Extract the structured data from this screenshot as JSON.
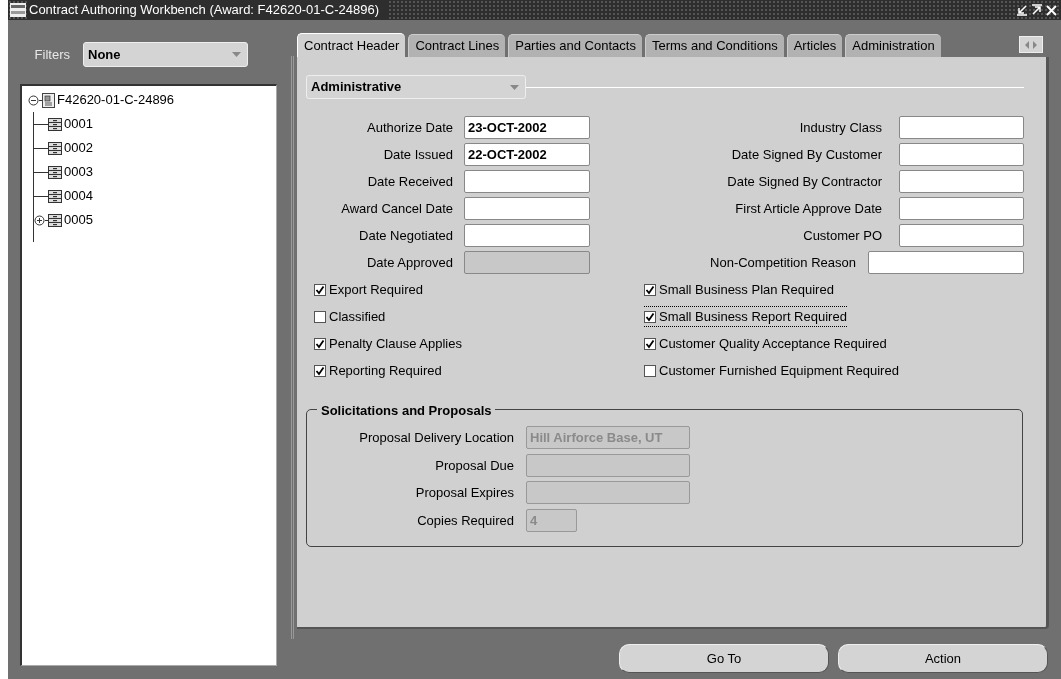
{
  "window": {
    "title": "Contract Authoring Workbench (Award: F42620-01-C-24896)"
  },
  "filters": {
    "label": "Filters",
    "value": "None"
  },
  "tree": [
    {
      "label": "F42620-01-C-24896",
      "kind": "contract",
      "expanded": true,
      "children": [
        {
          "label": "0001",
          "kind": "line"
        },
        {
          "label": "0002",
          "kind": "line"
        },
        {
          "label": "0003",
          "kind": "line"
        },
        {
          "label": "0004",
          "kind": "line"
        },
        {
          "label": "0005",
          "kind": "line",
          "expanded": false
        }
      ]
    }
  ],
  "tabs": [
    {
      "label": "Contract Header",
      "selected": true
    },
    {
      "label": "Contract Lines",
      "selected": false
    },
    {
      "label": "Parties and Contacts",
      "selected": false
    },
    {
      "label": "Terms and Conditions",
      "selected": false
    },
    {
      "label": "Articles",
      "selected": false
    },
    {
      "label": "Administration",
      "selected": false
    }
  ],
  "region_selector": {
    "value": "Administrative"
  },
  "fields_left": [
    {
      "label": "Authorize Date",
      "value": "23-OCT-2002",
      "disabled": false
    },
    {
      "label": "Date Issued",
      "value": "22-OCT-2002",
      "disabled": false
    },
    {
      "label": "Date Received",
      "disabled": false
    },
    {
      "label": "Award Cancel Date",
      "disabled": false
    },
    {
      "label": "Date Negotiated",
      "disabled": false
    },
    {
      "label": "Date Approved",
      "disabled": true
    }
  ],
  "fields_right": [
    {
      "label": "Industry Class",
      "kind": "normal"
    },
    {
      "label": "Date Signed By Customer",
      "kind": "normal"
    },
    {
      "label": "Date Signed By Contractor",
      "kind": "normal"
    },
    {
      "label": "First Article Approve Date",
      "kind": "normal"
    },
    {
      "label": "Customer PO",
      "kind": "normal"
    },
    {
      "label": "Non-Competition Reason",
      "kind": "wide"
    }
  ],
  "checkboxes_left": [
    {
      "label": "Export Required",
      "checked": true,
      "focused": false
    },
    {
      "label": "Classified",
      "checked": false,
      "focused": false
    },
    {
      "label": "Penalty Clause Applies",
      "checked": true,
      "focused": false
    },
    {
      "label": "Reporting Required",
      "checked": true,
      "focused": false
    }
  ],
  "checkboxes_right": [
    {
      "label": "Small Business Plan Required",
      "checked": true,
      "focused": false
    },
    {
      "label": "Small Business Report Required",
      "checked": true,
      "focused": true
    },
    {
      "label": "Customer Quality Acceptance Required",
      "checked": true,
      "focused": false
    },
    {
      "label": "Customer Furnished Equipment Required",
      "checked": false,
      "focused": false
    }
  ],
  "solicitations": {
    "title": "Solicitations and Proposals",
    "fields": [
      {
        "label": "Proposal Delivery Location",
        "value": "Hill Airforce Base, UT",
        "kind": "long",
        "disabled": true
      },
      {
        "label": "Proposal Due",
        "kind": "long",
        "disabled": true
      },
      {
        "label": "Proposal Expires",
        "kind": "long",
        "disabled": true
      },
      {
        "label": "Copies Required",
        "value": "4",
        "kind": "short",
        "disabled": true
      }
    ]
  },
  "buttons": [
    "Go To",
    "Action"
  ]
}
